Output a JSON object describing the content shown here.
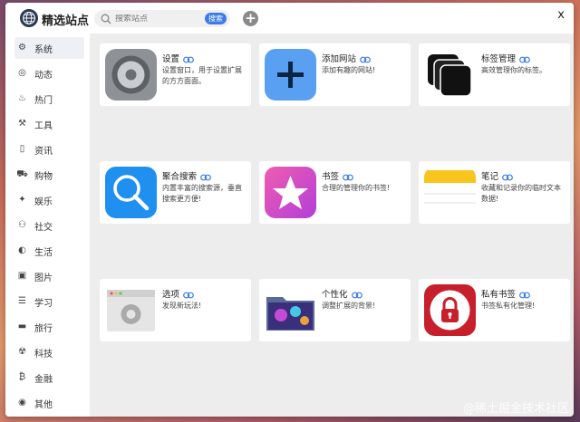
{
  "header": {
    "title": "精选站点",
    "search_placeholder": "搜索站点",
    "search_button": "搜索",
    "add_label": "+",
    "close_label": "x"
  },
  "sidebar": {
    "items": [
      {
        "label": "系统",
        "icon": "gear-icon",
        "glyph": "⚙"
      },
      {
        "label": "动态",
        "icon": "compass-icon",
        "glyph": "◎"
      },
      {
        "label": "热门",
        "icon": "flame-icon",
        "glyph": "♨"
      },
      {
        "label": "工具",
        "icon": "hammer-icon",
        "glyph": "⚒"
      },
      {
        "label": "资讯",
        "icon": "book-icon",
        "glyph": "▯"
      },
      {
        "label": "购物",
        "icon": "cart-icon",
        "glyph": "⛟"
      },
      {
        "label": "娱乐",
        "icon": "gamepad-icon",
        "glyph": "✦"
      },
      {
        "label": "社交",
        "icon": "people-icon",
        "glyph": "⚇"
      },
      {
        "label": "生活",
        "icon": "contrast-icon",
        "glyph": "◐"
      },
      {
        "label": "图片",
        "icon": "image-icon",
        "glyph": "▣"
      },
      {
        "label": "学习",
        "icon": "document-icon",
        "glyph": "☰"
      },
      {
        "label": "旅行",
        "icon": "bus-icon",
        "glyph": "▬"
      },
      {
        "label": "科技",
        "icon": "robot-icon",
        "glyph": "☢"
      },
      {
        "label": "金融",
        "icon": "bitcoin-icon",
        "glyph": "₿"
      },
      {
        "label": "其他",
        "icon": "chrome-icon",
        "glyph": "◉"
      }
    ]
  },
  "cards": [
    {
      "title": "设置",
      "desc": "设置窗口，用于设置扩展的方方面面。",
      "icon": "settings-gear-icon"
    },
    {
      "title": "添加网站",
      "desc": "添加有趣的网站!",
      "icon": "plus-icon"
    },
    {
      "title": "标签管理",
      "desc": "高效管理你的标签。",
      "icon": "stacked-tabs-icon"
    },
    {
      "title": "聚合搜索",
      "desc": "内置丰富的搜索源，垂直搜索更方便!",
      "icon": "magnifier-icon"
    },
    {
      "title": "书签",
      "desc": "合理的管理你的书签!",
      "icon": "star-icon"
    },
    {
      "title": "笔记",
      "desc": "收藏和记录你的临时文本数据!",
      "icon": "notes-icon"
    },
    {
      "title": "选项",
      "desc": "发现新玩法!",
      "icon": "window-gear-icon"
    },
    {
      "title": "个性化",
      "desc": "调整扩展的背景!",
      "icon": "folder-image-icon"
    },
    {
      "title": "私有书签",
      "desc": "书签私有化管理!",
      "icon": "lock-icon"
    }
  ],
  "watermark": "@稀土掘金技术社区",
  "colors": {
    "accent": "#3b7be8",
    "window_bg": "#ededed"
  }
}
